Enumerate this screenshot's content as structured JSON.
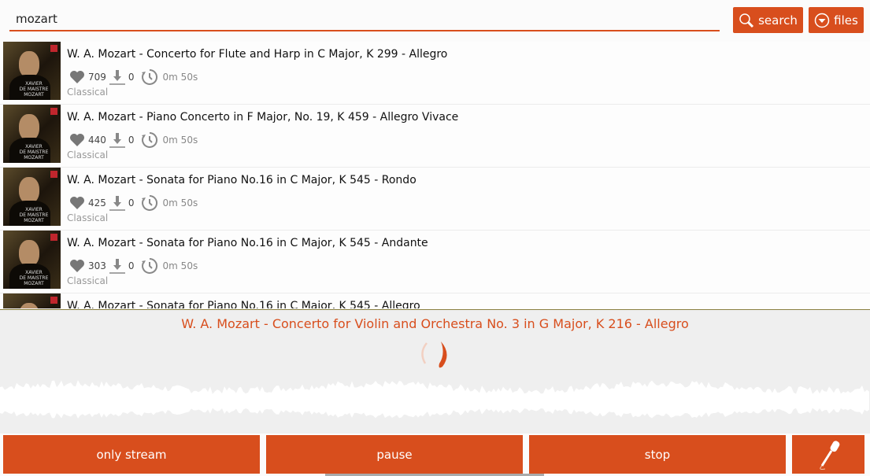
{
  "search": {
    "value": "mozart",
    "search_label": "search",
    "files_label": "files"
  },
  "tracks": [
    {
      "title": "W. A. Mozart - Concerto for Flute and Harp in C Major, K 299 - Allegro",
      "likes": "709",
      "downloads": "0",
      "duration": "0m 50s",
      "genre": "Classical"
    },
    {
      "title": "W. A. Mozart - Piano Concerto in F Major, No. 19, K 459 - Allegro Vivace",
      "likes": "440",
      "downloads": "0",
      "duration": "0m 50s",
      "genre": "Classical"
    },
    {
      "title": "W. A. Mozart - Sonata for Piano No.16 in C Major, K 545 - Rondo",
      "likes": "425",
      "downloads": "0",
      "duration": "0m 50s",
      "genre": "Classical"
    },
    {
      "title": "W. A. Mozart - Sonata for Piano No.16 in C Major, K 545 - Andante",
      "likes": "303",
      "downloads": "0",
      "duration": "0m 50s",
      "genre": "Classical"
    },
    {
      "title": "W. A. Mozart - Sonata for Piano No.16 in C Major, K 545 - Allegro",
      "likes": "",
      "downloads": "",
      "duration": "",
      "genre": ""
    }
  ],
  "album_art_text": "XAVIER DE MAISTRE MOZART",
  "player": {
    "now_playing": "W. A. Mozart - Concerto for Violin and Orchestra No. 3 in G Major, K 216 - Allegro"
  },
  "controls": {
    "only_stream": "only stream",
    "pause": "pause",
    "stop": "stop",
    "mic_icon": "microphone-icon"
  },
  "colors": {
    "accent": "#d84e1d"
  }
}
